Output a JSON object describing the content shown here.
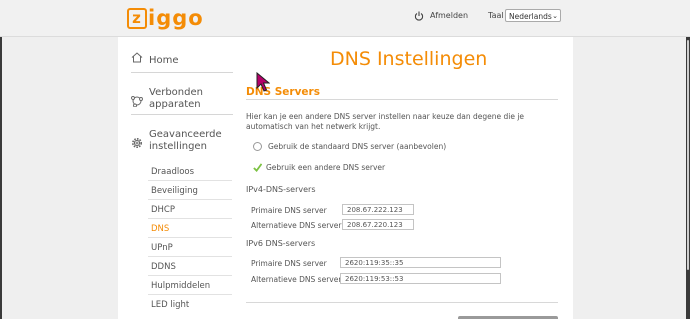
{
  "header": {
    "logo": "ziggo",
    "logout_label": "Afmelden",
    "language_label": "Taal",
    "language_value": "Nederlands"
  },
  "sidebar": {
    "main": [
      {
        "label": "Home",
        "icon": "house-icon"
      },
      {
        "label": "Verbonden apparaten",
        "icon": "network-icon"
      },
      {
        "label": "Geavanceerde instellingen",
        "icon": "gear-icon"
      }
    ],
    "sub": [
      {
        "label": "Draadloos",
        "active": false
      },
      {
        "label": "Beveiliging",
        "active": false
      },
      {
        "label": "DHCP",
        "active": false
      },
      {
        "label": "DNS",
        "active": true
      },
      {
        "label": "UPnP",
        "active": false
      },
      {
        "label": "DDNS",
        "active": false
      },
      {
        "label": "Hulpmiddelen",
        "active": false
      },
      {
        "label": "LED light",
        "active": false
      }
    ]
  },
  "main": {
    "page_title": "DNS Instellingen",
    "section_title": "DNS Servers",
    "description": "Hier kan je een andere DNS server instellen naar keuze dan degene die je automatisch van het netwerk krijgt.",
    "options": [
      {
        "label": "Gebruik de standaard DNS server (aanbevolen)",
        "selected": false
      },
      {
        "label": "Gebruik een andere DNS server",
        "selected": true
      }
    ],
    "ipv4": {
      "heading": "IPv4-DNS-servers",
      "primary_label": "Primaire DNS server",
      "primary_value": "208.67.222.123",
      "alternate_label": "Alternatieve DNS server",
      "alternate_value": "208.67.220.123"
    },
    "ipv6": {
      "heading": "IPv6 DNS-servers",
      "primary_label": "Primaire DNS server",
      "primary_value": "2620:119:35::35",
      "alternate_label": "Alternatieve DNS server",
      "alternate_value": "2620:119:53::53"
    }
  },
  "colors": {
    "accent": "#f48c06",
    "check": "#7cc242"
  }
}
